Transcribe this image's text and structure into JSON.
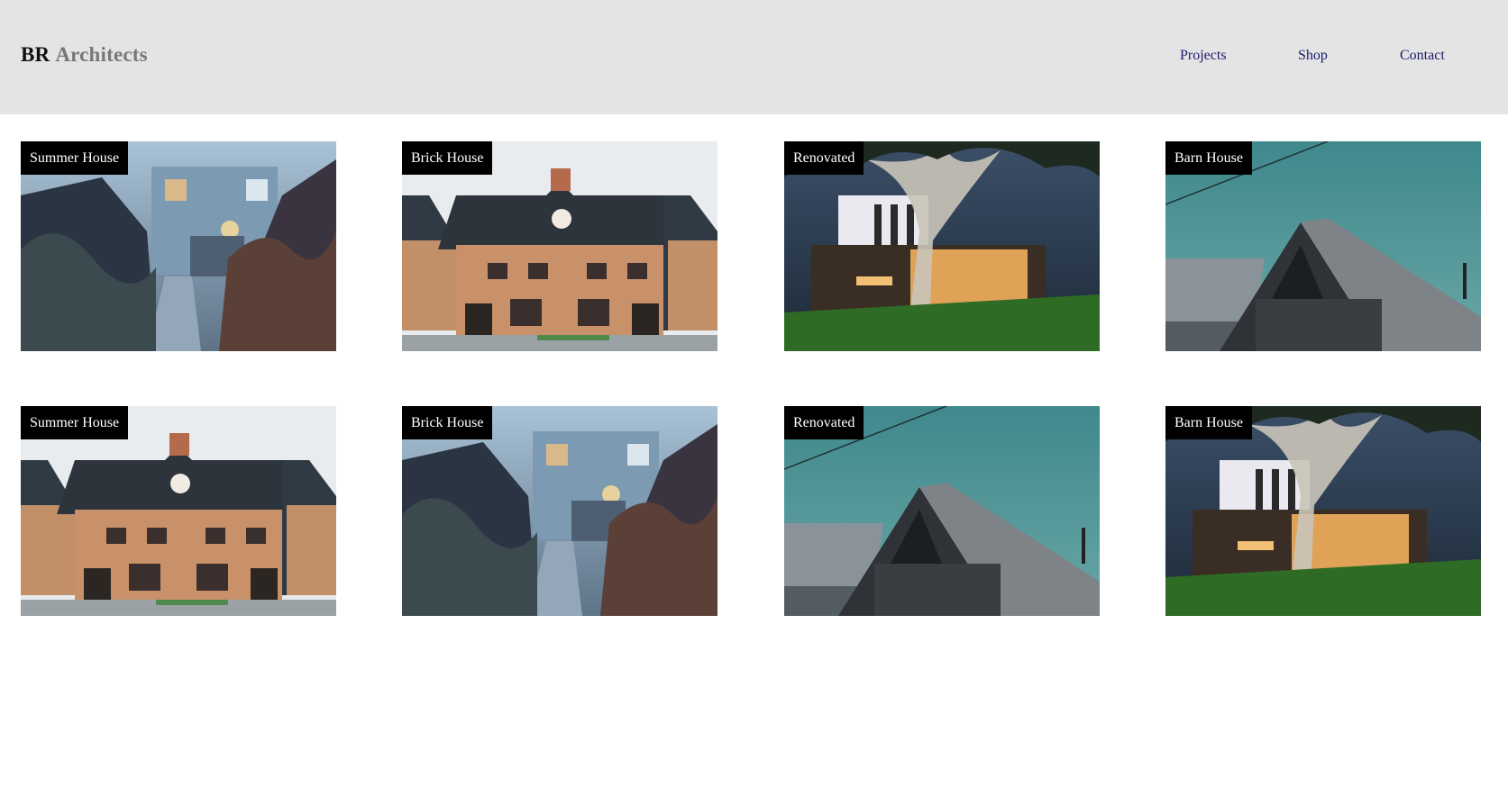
{
  "header": {
    "brand_bold": "BR",
    "brand_light": "Architects",
    "nav": [
      "Projects",
      "Shop",
      "Contact"
    ]
  },
  "gallery": {
    "cards": [
      {
        "label": "Summer House",
        "image": "summer-house-photo"
      },
      {
        "label": "Brick House",
        "image": "brick-house-photo"
      },
      {
        "label": "Renovated",
        "image": "renovated-house-photo"
      },
      {
        "label": "Barn House",
        "image": "barn-house-photo"
      },
      {
        "label": "Summer House",
        "image": "brick-house-photo"
      },
      {
        "label": "Brick House",
        "image": "summer-house-photo"
      },
      {
        "label": "Renovated",
        "image": "barn-house-photo"
      },
      {
        "label": "Barn House",
        "image": "renovated-house-photo"
      }
    ]
  },
  "colors": {
    "header_bg": "#e4e4e4",
    "label_bg": "#000000",
    "label_text": "#ffffff",
    "nav_link": "#1a1a6e",
    "brand_light": "#777777"
  }
}
